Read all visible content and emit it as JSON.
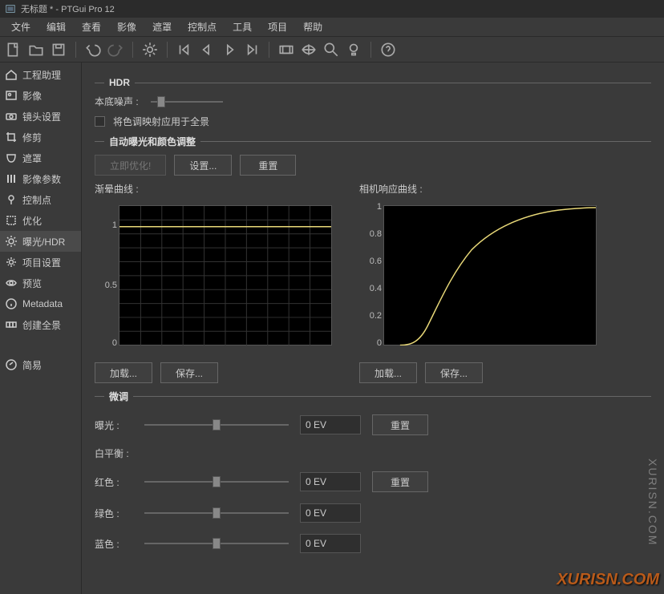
{
  "title": "无标题 * - PTGui Pro 12",
  "menu": [
    "文件",
    "编辑",
    "查看",
    "影像",
    "遮罩",
    "控制点",
    "工具",
    "项目",
    "帮助"
  ],
  "sidebar": [
    {
      "label": "工程助理"
    },
    {
      "label": "影像"
    },
    {
      "label": "镜头设置"
    },
    {
      "label": "修剪"
    },
    {
      "label": "遮罩"
    },
    {
      "label": "影像参数"
    },
    {
      "label": "控制点"
    },
    {
      "label": "优化"
    },
    {
      "label": "曝光/HDR"
    },
    {
      "label": "项目设置"
    },
    {
      "label": "预览"
    },
    {
      "label": "Metadata"
    },
    {
      "label": "创建全景"
    },
    {
      "label": "简易"
    }
  ],
  "hdr": {
    "header": "HDR",
    "noise_label": "本底噪声 :",
    "apply_label": "将色调映射应用于全景"
  },
  "auto": {
    "header": "自动曝光和颜色调整",
    "optimize": "立即优化!",
    "settings": "设置...",
    "reset": "重置"
  },
  "charts": {
    "vignette": "渐晕曲线 :",
    "response": "相机响应曲线 :",
    "load": "加载...",
    "save": "保存...",
    "ticks": [
      "1",
      "0.5",
      "0"
    ],
    "ticks2": [
      "1",
      "0.8",
      "0.6",
      "0.4",
      "0.2",
      "0"
    ]
  },
  "fine": {
    "header": "微调",
    "exposure": "曝光 :",
    "wb": "白平衡 :",
    "red": "红色 :",
    "green": "绿色 :",
    "blue": "蓝色 :",
    "reset": "重置",
    "val": "0 EV"
  },
  "watermark": "XURISN.COM",
  "watermark2": "XURISN.COM",
  "chart_data": [
    {
      "type": "line",
      "title": "渐晕曲线",
      "xlim": [
        0,
        1
      ],
      "ylim": [
        0,
        1
      ],
      "x": [
        0,
        1
      ],
      "y": [
        1,
        1
      ]
    },
    {
      "type": "line",
      "title": "相机响应曲线",
      "xlim": [
        0,
        1
      ],
      "ylim": [
        0,
        1
      ],
      "x": [
        0,
        0.05,
        0.1,
        0.15,
        0.2,
        0.25,
        0.3,
        0.35,
        0.4,
        0.45,
        0.5,
        0.55,
        0.6,
        0.65,
        0.7,
        0.75,
        0.8,
        0.85,
        0.9,
        0.95,
        1
      ],
      "y": [
        0,
        0.01,
        0.05,
        0.15,
        0.3,
        0.45,
        0.58,
        0.68,
        0.75,
        0.8,
        0.84,
        0.87,
        0.9,
        0.92,
        0.94,
        0.955,
        0.965,
        0.975,
        0.985,
        0.993,
        1
      ]
    }
  ]
}
